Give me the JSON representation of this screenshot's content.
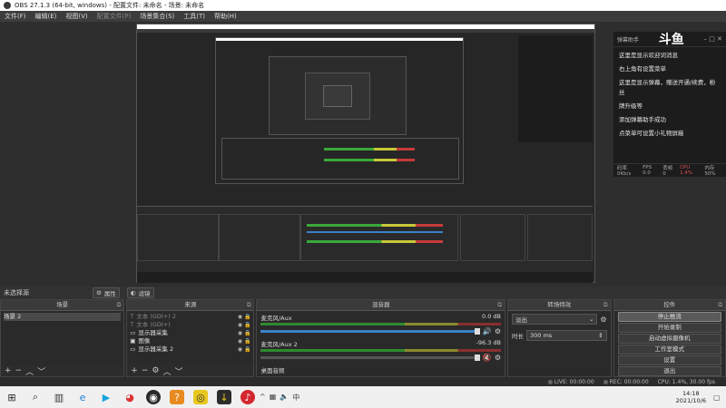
{
  "window": {
    "title": "OBS 27.1.3 (64-bit, windows) - 配置文件: 未命名 - 场景: 未命名"
  },
  "menu": [
    {
      "label": "文件(F)",
      "enabled": true
    },
    {
      "label": "编辑(E)",
      "enabled": true
    },
    {
      "label": "视图(V)",
      "enabled": true
    },
    {
      "label": "配置文件(P)",
      "enabled": false
    },
    {
      "label": "场景集合(S)",
      "enabled": true
    },
    {
      "label": "工具(T)",
      "enabled": true
    },
    {
      "label": "帮助(H)",
      "enabled": true
    }
  ],
  "chat": {
    "header": "弹幕助手",
    "logo": "斗鱼",
    "lines": [
      "这里是显示欢迎词消息",
      "",
      "右上角有设置菜单",
      "这里是显示弹幕，赠送开通/续费，粉丝",
      "牌升级等",
      "添加弹幕助手成功",
      "",
      "点菜单可设置小礼物屏蔽"
    ],
    "footer": [
      "码率 0Kb/s",
      "FPS 0.0",
      "丢帧 0",
      "CPU 1.4%",
      "内存 50%"
    ]
  },
  "scenebar": {
    "current": "未选择源",
    "properties": "属性",
    "filters": "滤镜"
  },
  "scenes": {
    "title": "场景",
    "items": [
      "场景 2"
    ]
  },
  "sources": {
    "title": "来源",
    "items": [
      {
        "label": "文本 (GDI+) 2",
        "icon": "text-icon",
        "dim": true
      },
      {
        "label": "文本 (GDI+)",
        "icon": "text-icon",
        "dim": true
      },
      {
        "label": "显示器采集",
        "icon": "monitor-icon",
        "dim": false
      },
      {
        "label": "图像",
        "icon": "image-icon",
        "dim": false
      },
      {
        "label": "显示器采集 2",
        "icon": "monitor-icon",
        "dim": false
      }
    ]
  },
  "mixer": {
    "title": "混音器",
    "channels": [
      {
        "name": "麦克风/Aux",
        "db": "0.0 dB",
        "muted": false
      },
      {
        "name": "麦克风/Aux 2",
        "db": "-96.3 dB",
        "muted": true
      }
    ],
    "desktop": "桌面音频"
  },
  "transitions": {
    "title": "转场特效",
    "selected": "淡出",
    "duration_label": "时长",
    "duration": "300 ms"
  },
  "controls": {
    "title": "控件",
    "buttons": [
      "停止推流",
      "开始录制",
      "启动虚拟摄像机",
      "工作室模式",
      "设置",
      "退出"
    ],
    "active_index": 0
  },
  "status": {
    "live": "LIVE: 00:00:00",
    "rec": "REC: 00:00:00",
    "cpu": "CPU: 1.4%, 30.00 fps"
  },
  "taskbar": {
    "time": "14:18",
    "date": "2021/10/6",
    "apps": [
      "windows-icon",
      "search-icon",
      "task-view-icon",
      "edge-icon",
      "media-icon",
      "chrome-icon",
      "obs-icon",
      "app-orange-icon",
      "app-owl-icon",
      "app-dark-icon",
      "netease-icon"
    ]
  }
}
